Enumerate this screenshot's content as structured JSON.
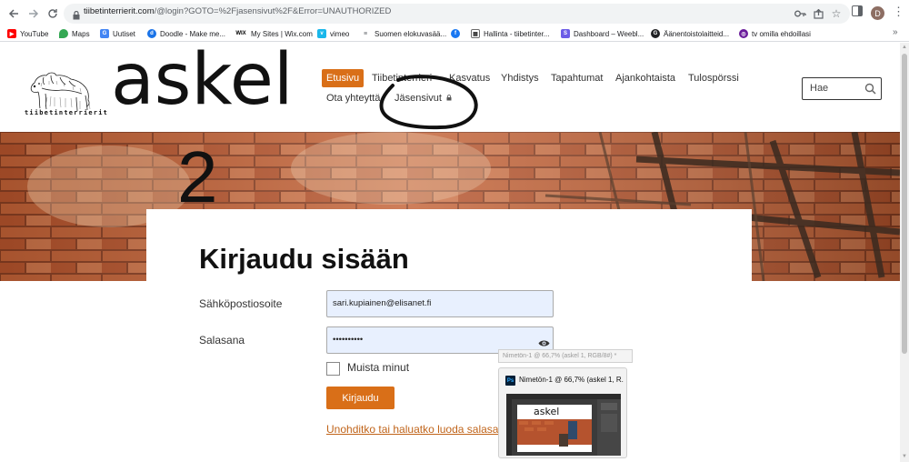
{
  "browser": {
    "url_main": "tiibetinterrierit.com",
    "url_path": "/@login?GOTO=%2Fjasensivut%2F&Error=UNAUTHORIZED",
    "profile_initial": "D",
    "bookmarks": [
      {
        "label": "YouTube",
        "icon": "youtube-icon",
        "color": "#ff0000"
      },
      {
        "label": "Maps",
        "icon": "maps-icon",
        "color": "#34a853"
      },
      {
        "label": "Uutiset",
        "icon": "news-icon",
        "color": "#4285f4"
      },
      {
        "label": "Doodle - Make me...",
        "icon": "doodle-icon",
        "color": "#1a73e8"
      },
      {
        "label": "My Sites | Wix.com",
        "icon": "wix-icon",
        "color": "#000000"
      },
      {
        "label": "vimeo",
        "icon": "vimeo-icon",
        "color": "#1ab7ea"
      },
      {
        "label": "Suomen elokuvasää...",
        "icon": "film-icon",
        "color": "#5f6368"
      },
      {
        "label": "",
        "icon": "facebook-icon",
        "color": "#1877f2"
      },
      {
        "label": "Hallinta - tiibetinter...",
        "icon": "admin-icon",
        "color": "#6b6b6b"
      },
      {
        "label": "Dashboard – Weebl...",
        "icon": "weebly-icon",
        "color": "#6c5ce7"
      },
      {
        "label": "Äänentoistolaitteid...",
        "icon": "g-icon",
        "color": "#202124"
      },
      {
        "label": "tv omilla ehdoillasi",
        "icon": "tv-icon",
        "color": "#6a1b9a"
      }
    ]
  },
  "site": {
    "logo_text": "askel",
    "logo_dog_caption": "tiibetinterrierit",
    "nav": [
      {
        "label": "Etusivu",
        "active": true
      },
      {
        "label": "Tiibetinterrieri",
        "active": false
      },
      {
        "label": "Kasvatus",
        "active": false
      },
      {
        "label": "Yhdistys",
        "active": false
      },
      {
        "label": "Tapahtumat",
        "active": false
      },
      {
        "label": "Ajankohtaista",
        "active": false
      },
      {
        "label": "Tulospörssi",
        "active": false
      },
      {
        "label": "Ota yhteyttä",
        "active": false
      },
      {
        "label": "Jäsensivut",
        "active": false
      }
    ],
    "search_placeholder": "Hae",
    "annotation_number": "2"
  },
  "login": {
    "title": "Kirjaudu sisään",
    "email_label": "Sähköpostiosoite",
    "email_value": "sari.kupiainen@elisanet.fi",
    "password_label": "Salasana",
    "password_value": "••••••••••",
    "remember_label": "Muista minut",
    "submit_label": "Kirjaudu",
    "forgot_link": "Unohditko tai haluatko luoda salasana"
  },
  "taskbar_preview": {
    "tooltip": "Nimetön-1 @ 66,7% (askel 1, RGB/8#) *",
    "window_title": "Nimetön-1 @ 66,7% (askel 1, R...",
    "app_badge": "Ps",
    "mini_logo": "askel"
  }
}
